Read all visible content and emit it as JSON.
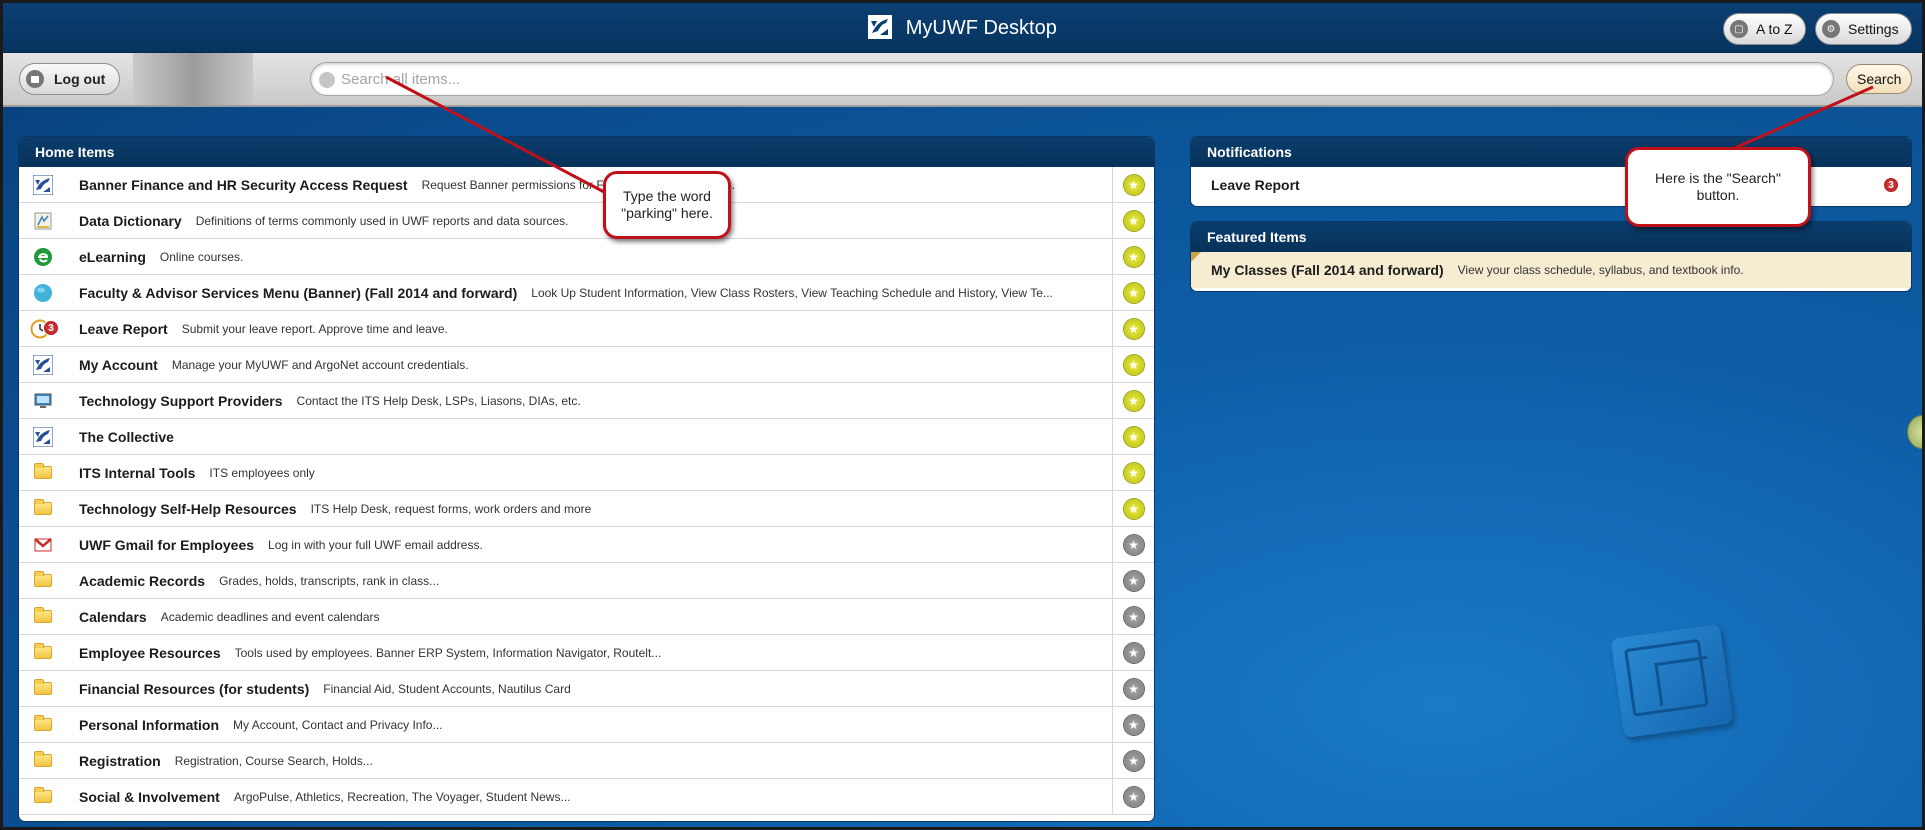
{
  "header": {
    "title": "MyUWF Desktop",
    "a_to_z_label": "A to Z",
    "settings_label": "Settings"
  },
  "toolbar": {
    "logout_label": "Log out",
    "search_placeholder": "Search all items...",
    "search_label": "Search"
  },
  "home_items": {
    "title": "Home Items",
    "items": [
      {
        "title": "Banner Finance and HR Security Access Request",
        "desc": "Request Banner permissions for Finance and HR modules.",
        "icon": "uwf-logo-icon",
        "favorite": true
      },
      {
        "title": "Data Dictionary",
        "desc": "Definitions of terms commonly used in UWF reports and data sources.",
        "icon": "dictionary-icon",
        "favorite": true
      },
      {
        "title": "eLearning",
        "desc": "Online courses.",
        "icon": "elearning-icon",
        "favorite": true
      },
      {
        "title": "Faculty & Advisor Services Menu (Banner) (Fall 2014 and forward)",
        "desc": "Look Up Student Information, View Class Rosters, View Teaching Schedule and History, View Te...",
        "icon": "globe-icon",
        "favorite": true
      },
      {
        "title": "Leave Report",
        "desc": "Submit your leave report. Approve time and leave.",
        "icon": "clock-icon",
        "badge": "3",
        "favorite": true
      },
      {
        "title": "My Account",
        "desc": "Manage your MyUWF and ArgoNet account credentials.",
        "icon": "uwf-logo-icon",
        "favorite": true
      },
      {
        "title": "Technology Support Providers",
        "desc": "Contact the ITS Help Desk, LSPs, Liasons, DIAs, etc.",
        "icon": "monitor-icon",
        "favorite": true
      },
      {
        "title": "The Collective",
        "desc": "",
        "icon": "uwf-logo-icon",
        "favorite": true
      },
      {
        "title": "ITS Internal Tools",
        "desc": "ITS employees only",
        "icon": "folder-icon",
        "favorite": true
      },
      {
        "title": "Technology Self-Help Resources",
        "desc": "ITS Help Desk, request forms, work orders and more",
        "icon": "folder-icon",
        "favorite": true
      },
      {
        "title": "UWF Gmail for Employees",
        "desc": "Log in with your full UWF email address.",
        "icon": "gmail-icon",
        "favorite": false
      },
      {
        "title": "Academic Records",
        "desc": "Grades, holds, transcripts, rank in class...",
        "icon": "folder-icon",
        "favorite": false
      },
      {
        "title": "Calendars",
        "desc": "Academic deadlines and event calendars",
        "icon": "folder-icon",
        "favorite": false
      },
      {
        "title": "Employee Resources",
        "desc": "Tools used by employees. Banner ERP System, Information Navigator, Routelt...",
        "icon": "folder-icon",
        "favorite": false
      },
      {
        "title": "Financial Resources (for students)",
        "desc": "Financial Aid, Student Accounts, Nautilus Card",
        "icon": "folder-icon",
        "favorite": false
      },
      {
        "title": "Personal Information",
        "desc": "My Account, Contact and Privacy Info...",
        "icon": "folder-icon",
        "favorite": false
      },
      {
        "title": "Registration",
        "desc": "Registration, Course Search, Holds...",
        "icon": "folder-icon",
        "favorite": false
      },
      {
        "title": "Social & Involvement",
        "desc": "ArgoPulse, Athletics, Recreation, The Voyager, Student News...",
        "icon": "folder-icon",
        "favorite": false
      }
    ]
  },
  "notifications": {
    "title": "Notifications",
    "items": [
      {
        "title": "Leave Report",
        "count": "3"
      }
    ]
  },
  "featured": {
    "title": "Featured Items",
    "items": [
      {
        "title": "My Classes (Fall 2014 and forward)",
        "desc": "View your class schedule, syllabus, and textbook info."
      }
    ]
  },
  "callouts": {
    "search_input_note": "Type the word \"parking\" here.",
    "search_button_note": "Here is the \"Search\" button."
  },
  "colors": {
    "header_bg": "#07345f",
    "page_bg": "#0d4f8b",
    "favorite_on": "#c9cf22",
    "favorite_off": "#8a8a8a",
    "callout_border": "#c0101a",
    "badge": "#b51a1a"
  }
}
